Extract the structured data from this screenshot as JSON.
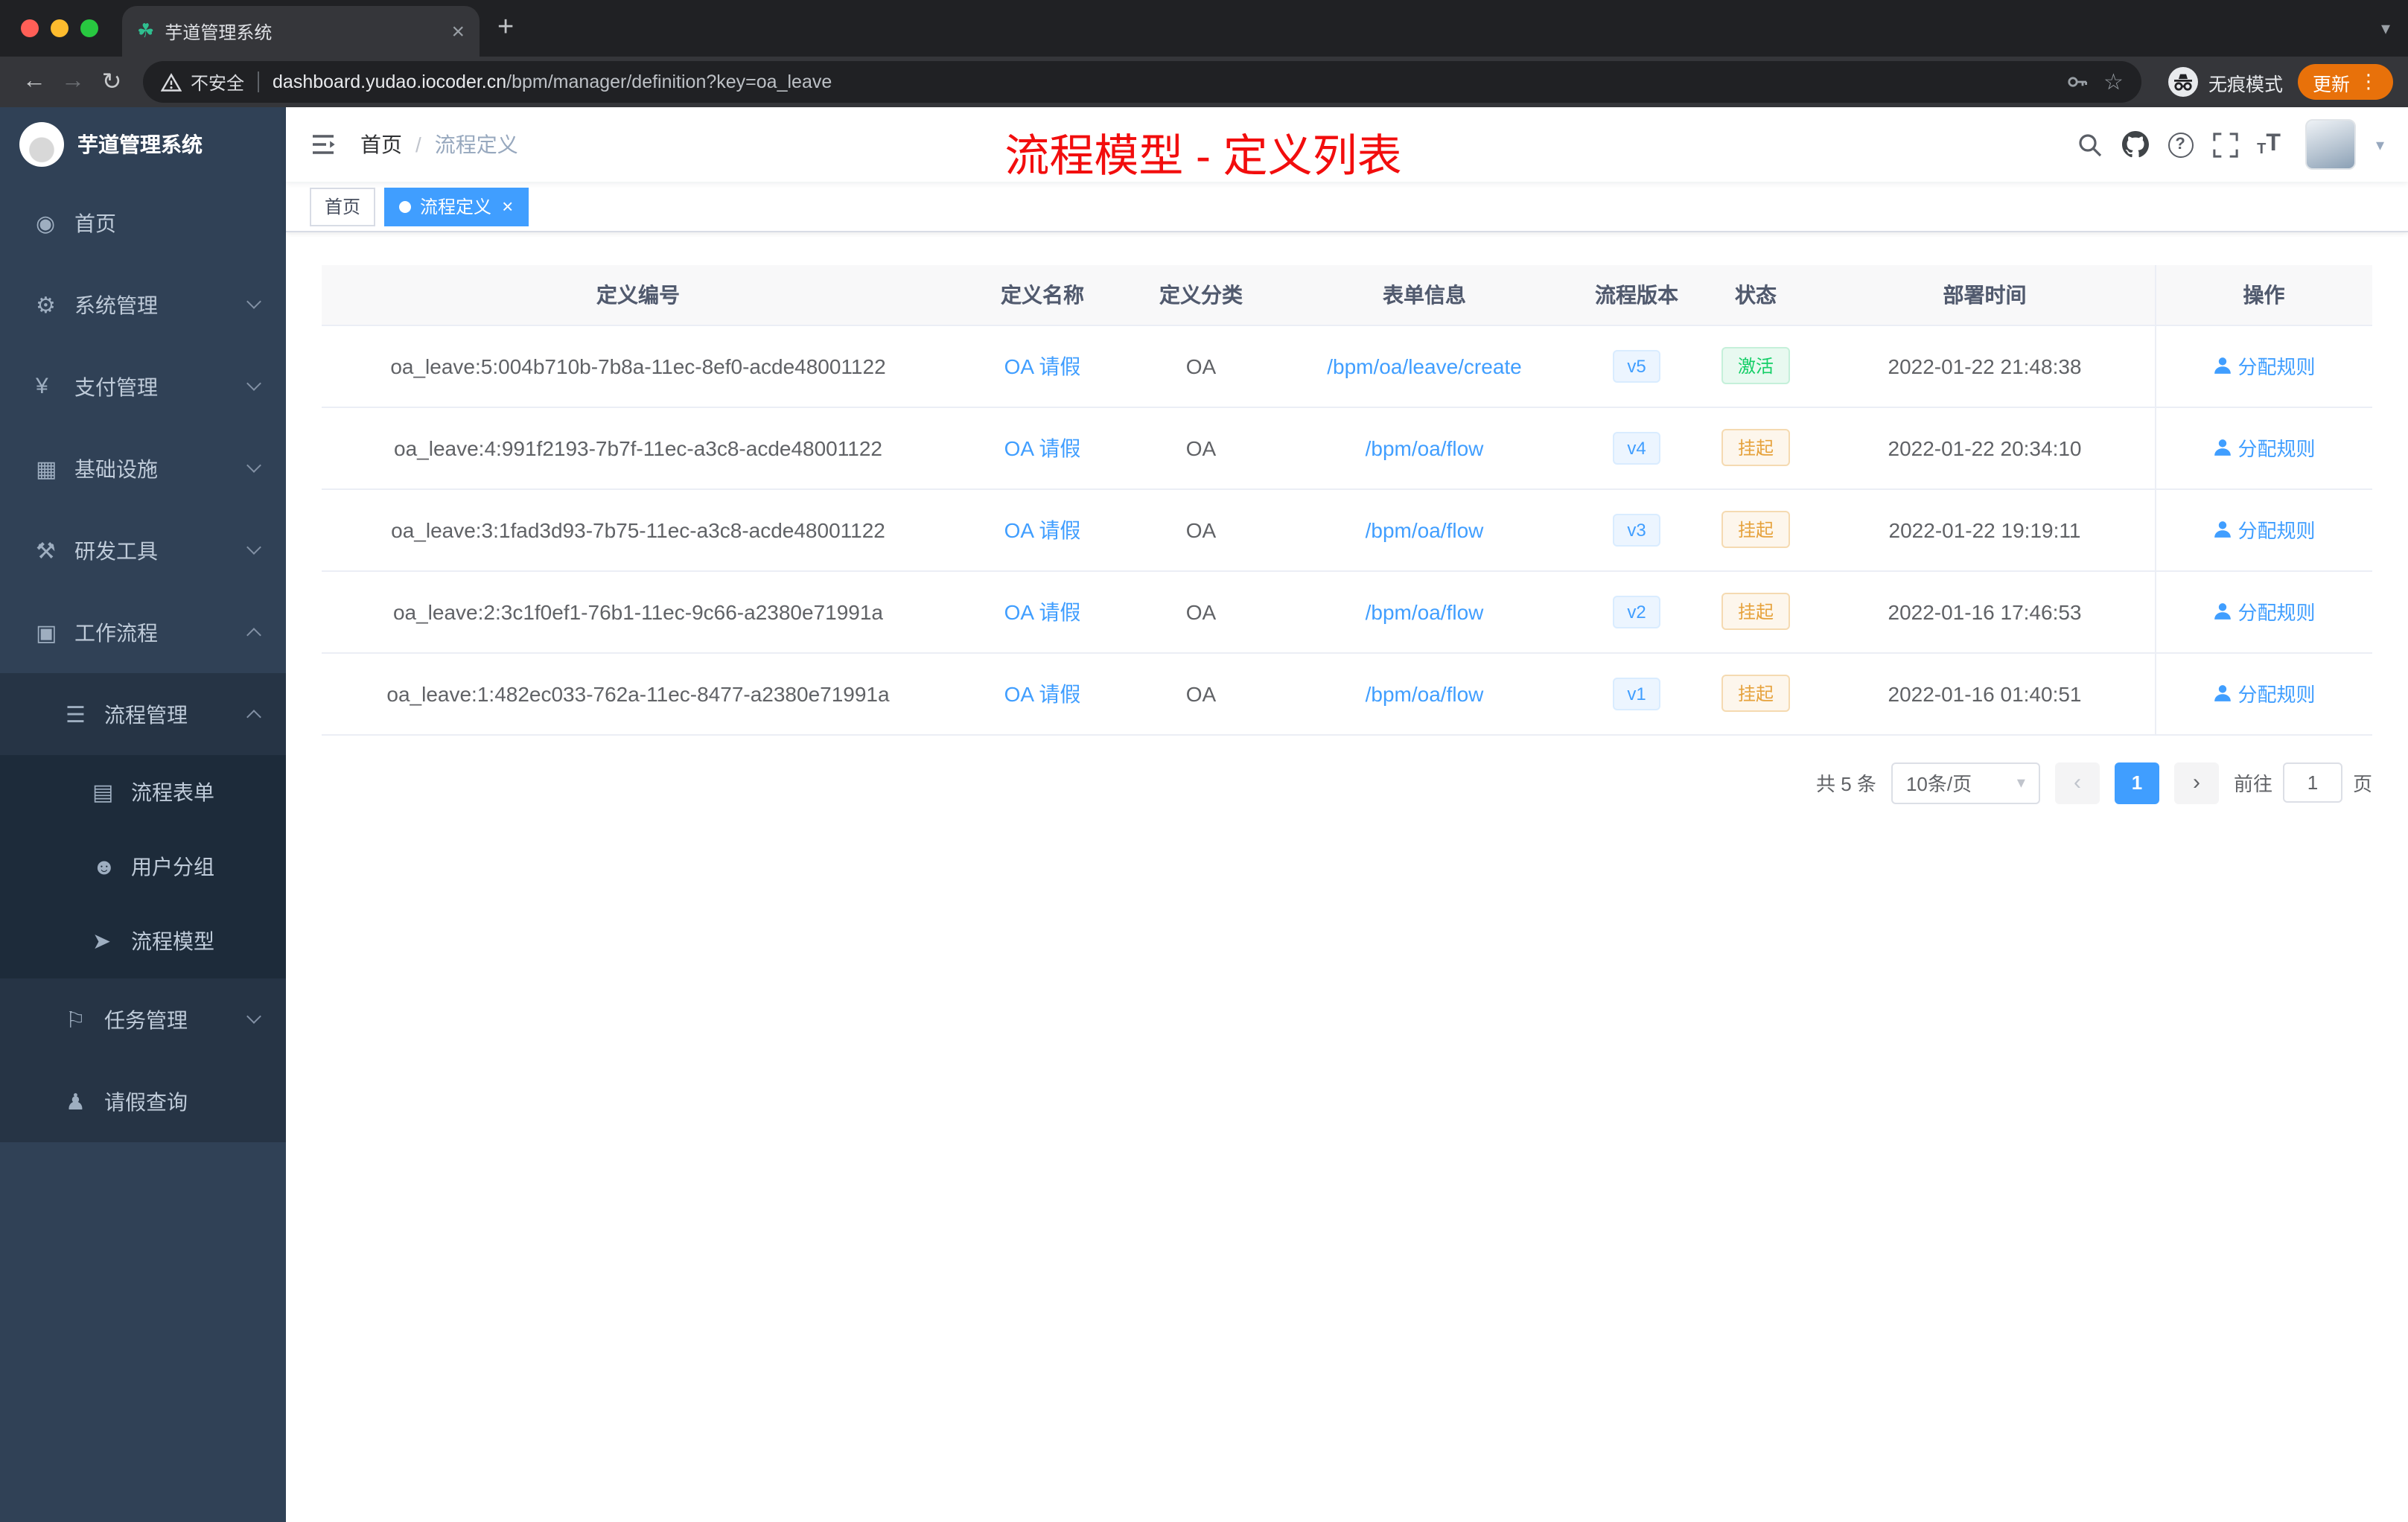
{
  "colors": {
    "accent_blue": "#409eff",
    "success_green": "#13ce66",
    "warning_orange": "#e6a23c",
    "annotation_red": "#f20d0d",
    "sidebar_bg": "#304156",
    "update_pill_orange": "#e8710a"
  },
  "icons": {
    "tab_favicon": "☘",
    "close": "×",
    "new_tab": "+",
    "caret_down": "▾",
    "back": "←",
    "forward": "→",
    "reload": "↻",
    "star": "☆",
    "more_menu": "⋮",
    "question": "?",
    "fontsize": "T",
    "home": "◉",
    "system": "⚙",
    "payment": "¥",
    "infra": "▦",
    "devtools": "⚒",
    "workflow": "▣",
    "process_mgmt": "☰",
    "process_form": "▤",
    "user_group": "☻",
    "process_model": "➤",
    "task_mgmt": "⚐",
    "leave_query": "♟",
    "select_caret": "▾",
    "prev": "‹",
    "next": "›"
  },
  "browser": {
    "tab_title": "芋道管理系统",
    "security_chip": "不安全",
    "url_host": "dashboard.yudao.iocoder.cn",
    "url_path": "/bpm/manager/definition?key=oa_leave",
    "incognito_label": "无痕模式",
    "update_button": "更新"
  },
  "sidebar": {
    "logo_title": "芋道管理系统",
    "items": {
      "home": "首页",
      "system": "系统管理",
      "payment": "支付管理",
      "infra": "基础设施",
      "devtools": "研发工具",
      "workflow": "工作流程",
      "process_mgmt": "流程管理",
      "process_form": "流程表单",
      "user_group": "用户分组",
      "process_model": "流程模型",
      "task_mgmt": "任务管理",
      "leave_query": "请假查询"
    }
  },
  "header": {
    "breadcrumb_home": "首页",
    "breadcrumb_separator": "/",
    "breadcrumb_current": "流程定义",
    "annotation": "流程模型 - 定义列表"
  },
  "tags": {
    "home": "首页",
    "active": "流程定义",
    "active_close": "×"
  },
  "table": {
    "columns": [
      "定义编号",
      "定义名称",
      "定义分类",
      "表单信息",
      "流程版本",
      "状态",
      "部署时间",
      "操作"
    ],
    "rows": [
      {
        "id": "oa_leave:5:004b710b-7b8a-11ec-8ef0-acde48001122",
        "name": "OA 请假",
        "category": "OA",
        "form": "/bpm/oa/leave/create",
        "version": "v5",
        "status": "激活",
        "time": "2022-01-22 21:48:38",
        "action": "分配规则"
      },
      {
        "id": "oa_leave:4:991f2193-7b7f-11ec-a3c8-acde48001122",
        "name": "OA 请假",
        "category": "OA",
        "form": "/bpm/oa/flow",
        "version": "v4",
        "status": "挂起",
        "time": "2022-01-22 20:34:10",
        "action": "分配规则"
      },
      {
        "id": "oa_leave:3:1fad3d93-7b75-11ec-a3c8-acde48001122",
        "name": "OA 请假",
        "category": "OA",
        "form": "/bpm/oa/flow",
        "version": "v3",
        "status": "挂起",
        "time": "2022-01-22 19:19:11",
        "action": "分配规则"
      },
      {
        "id": "oa_leave:2:3c1f0ef1-76b1-11ec-9c66-a2380e71991a",
        "name": "OA 请假",
        "category": "OA",
        "form": "/bpm/oa/flow",
        "version": "v2",
        "status": "挂起",
        "time": "2022-01-16 17:46:53",
        "action": "分配规则"
      },
      {
        "id": "oa_leave:1:482ec033-762a-11ec-8477-a2380e71991a",
        "name": "OA 请假",
        "category": "OA",
        "form": "/bpm/oa/flow",
        "version": "v1",
        "status": "挂起",
        "time": "2022-01-16 01:40:51",
        "action": "分配规则"
      }
    ]
  },
  "pagination": {
    "total": "共 5 条",
    "page_size": "10条/页",
    "current_page": "1",
    "goto_label": "前往",
    "goto_value": "1",
    "goto_unit": "页"
  }
}
